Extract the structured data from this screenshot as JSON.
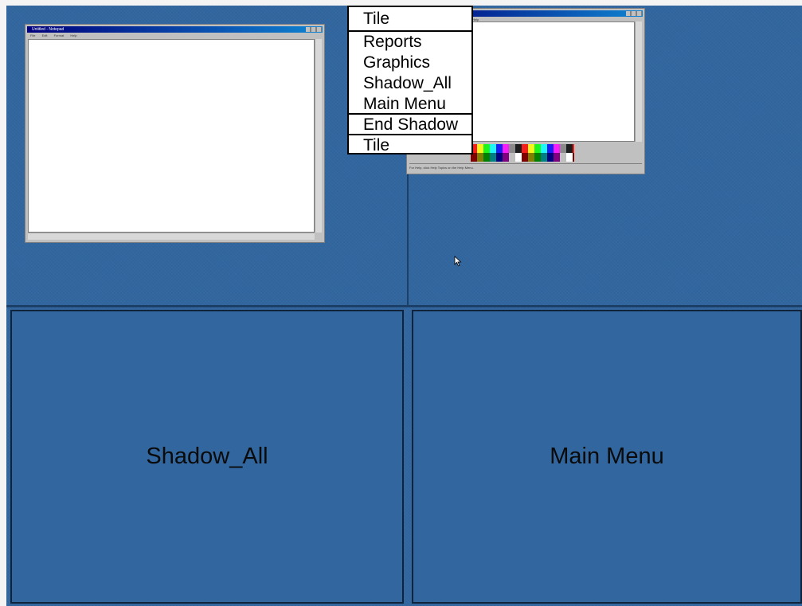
{
  "desktop": {
    "quadrants": {
      "bottom_left_label": "Shadow_All",
      "bottom_right_label": "Main Menu"
    }
  },
  "thumbnails": {
    "notepad": {
      "title": "Untitled - Notepad",
      "menu": [
        "File",
        "Edit",
        "Format",
        "Help"
      ]
    },
    "paint": {
      "menu_right": "Help",
      "status": "For Help, click Help Topics on the Help Menu."
    }
  },
  "popup_menu": {
    "items": [
      "Tile",
      "Reports",
      "Graphics",
      "Shadow_All",
      "Main Menu",
      "End Shadow",
      "Tile"
    ]
  },
  "colors": {
    "desktop_blue": "#31669f",
    "divider": "#1b3f66",
    "menu_background": "#ffffff"
  },
  "icons": {
    "cursor": "arrow-cursor-icon"
  }
}
